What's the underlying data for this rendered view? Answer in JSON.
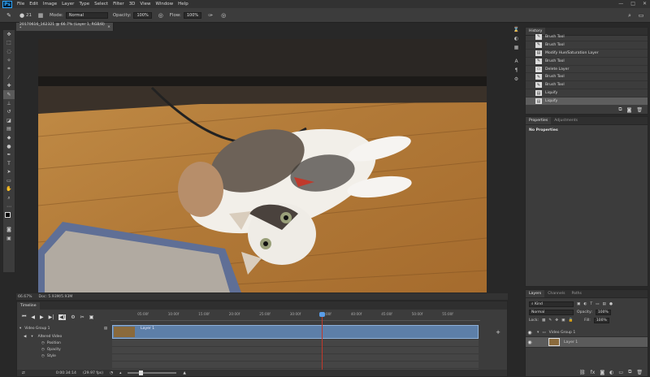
{
  "menubar": {
    "logo": "Ps",
    "items": [
      "File",
      "Edit",
      "Image",
      "Layer",
      "Type",
      "Select",
      "Filter",
      "3D",
      "View",
      "Window",
      "Help"
    ],
    "controls": [
      "—",
      "□",
      "✕"
    ]
  },
  "options": {
    "mode_label": "Mode:",
    "mode_value": "Normal",
    "opacity_label": "Opacity:",
    "opacity_value": "100%",
    "flow_label": "Flow:",
    "flow_value": "100%",
    "brush_size": "21"
  },
  "document": {
    "tab_title": "20170616_162321 @ 66.7% (Layer 1, RGB/8) *",
    "tab_close": "×",
    "zoom": "66.67%",
    "doc_info": "Doc: 5.93M/5.93M"
  },
  "history": {
    "tab": "History",
    "items": [
      "Brush Tool",
      "Brush Tool",
      "Modify Hue/Saturation Layer",
      "Brush Tool",
      "Delete Layer",
      "Brush Tool",
      "Brush Tool",
      "Liquify",
      "Liquify"
    ],
    "selected_index": 8
  },
  "properties": {
    "tabs": [
      "Properties",
      "Adjustments"
    ],
    "empty_text": "No Properties"
  },
  "layers": {
    "tabs": [
      "Layers",
      "Channels",
      "Paths"
    ],
    "kind": "Kind",
    "blend": "Normal",
    "opacity_label": "Opacity:",
    "opacity_value": "100%",
    "lock_label": "Lock:",
    "fill_label": "Fill:",
    "fill_value": "100%",
    "items": [
      {
        "name": "Video Group 1",
        "type": "group"
      },
      {
        "name": "Layer 1",
        "type": "layer"
      }
    ]
  },
  "timeline": {
    "tab": "Timeline",
    "ruler_ticks": [
      "05:00f",
      "10:00f",
      "15:00f",
      "20:00f",
      "25:00f",
      "30:00f",
      "35:00f",
      "40:00f",
      "45:00f",
      "50:00f",
      "55:00f"
    ],
    "group_label": "Video Group 1",
    "clip_name": "Layer 1",
    "track_rows": [
      "Altered Video",
      "Position",
      "Opacity",
      "Style"
    ],
    "timecode": "0:00:34:14",
    "fps": "(29.97 fps)",
    "playhead_progress": 0.573
  }
}
